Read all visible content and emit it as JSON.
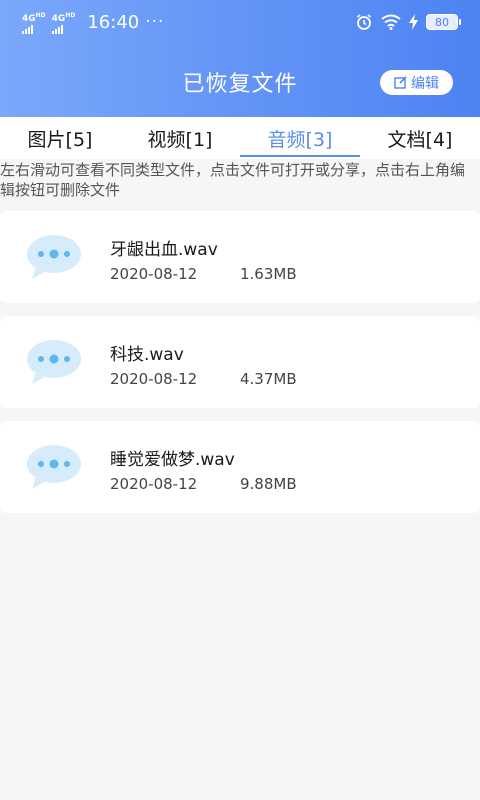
{
  "status_bar": {
    "network_1": "4G",
    "network_2": "4G",
    "network_sup": "HD",
    "time": "16:40",
    "more": "···",
    "battery": "80"
  },
  "header": {
    "title": "已恢复文件",
    "edit_label": "编辑"
  },
  "tabs": [
    {
      "label": "图片[5]",
      "active": false
    },
    {
      "label": "视频[1]",
      "active": false
    },
    {
      "label": "音频[3]",
      "active": true
    },
    {
      "label": "文档[4]",
      "active": false
    }
  ],
  "hint": "左右滑动可查看不同类型文件，点击文件可打开或分享，点击右上角编辑按钮可删除文件",
  "files": [
    {
      "name": "牙龈出血.wav",
      "date": "2020-08-12",
      "size": "1.63MB"
    },
    {
      "name": "科技.wav",
      "date": "2020-08-12",
      "size": "4.37MB"
    },
    {
      "name": "睡觉爱做梦.wav",
      "date": "2020-08-12",
      "size": "9.88MB"
    }
  ],
  "colors": {
    "header_start": "#7aa8fb",
    "header_end": "#4d82f2",
    "accent": "#5c8de8",
    "icon_bubble": "#d6ecfb",
    "icon_dots": "#5cb7f2"
  },
  "icons": {
    "file_icon": "speech-bubble-icon",
    "edit_icon": "edit-icon"
  }
}
